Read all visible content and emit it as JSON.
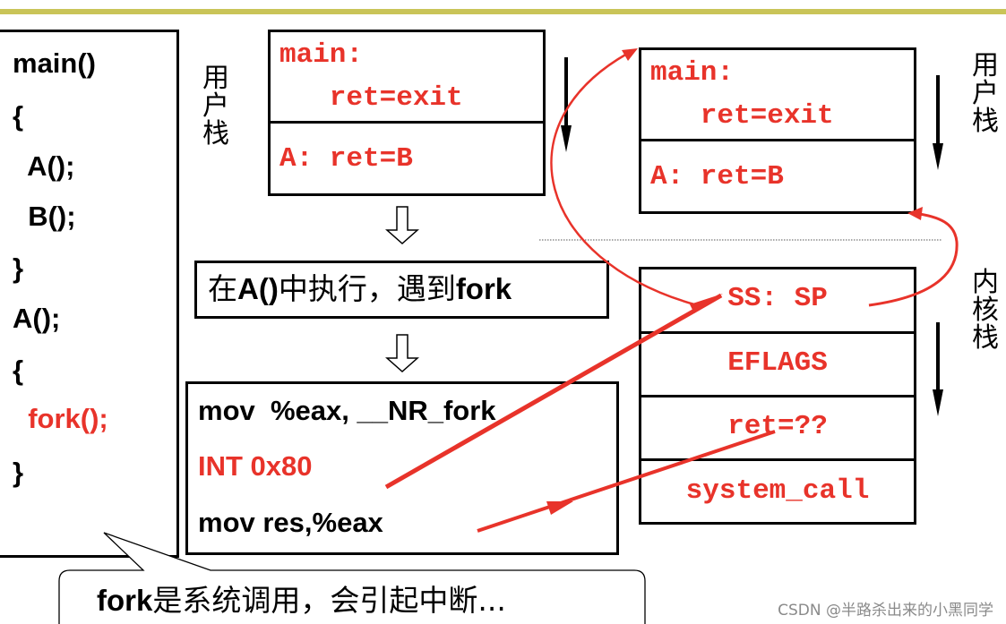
{
  "code_panel": {
    "lines": [
      "main()",
      "{",
      "  A();",
      "  B();",
      "}",
      "A();",
      "{",
      "  fork();",
      "}"
    ],
    "highlight_line": "  fork();"
  },
  "user_stack_left": {
    "label": "用户栈",
    "label_chars": [
      "用",
      "户",
      "栈"
    ],
    "frames": [
      {
        "line1": "main:",
        "line2": "   ret=exit"
      },
      {
        "line1": "A: ret=B"
      }
    ]
  },
  "flow": {
    "step1": {
      "prefix": "在",
      "bold1": "A()",
      "middle": "中执行，遇到",
      "bold2": "fork"
    },
    "asm": {
      "line1": "mov  %eax, __NR_fork",
      "line2": "INT 0x80",
      "line3": "mov res,%eax"
    }
  },
  "user_stack_right": {
    "label_chars": [
      "用",
      "户",
      "栈"
    ],
    "frames": [
      {
        "line1": "main:",
        "line2": "   ret=exit"
      },
      {
        "line1": "A: ret=B"
      }
    ]
  },
  "kernel_stack": {
    "label": "内核栈",
    "label_chars": [
      "内",
      "核",
      "栈"
    ],
    "frames": [
      "SS: SP",
      "EFLAGS",
      "ret=??",
      "system_call"
    ]
  },
  "callout": {
    "bold": "fork",
    "text": "是系统调用，会引起中断..."
  },
  "colors": {
    "accent_red": "#e8332a",
    "top_bar": "#c9c458",
    "watermark": "#8a8a8a"
  },
  "watermark": "CSDN @半路杀出来的小黑同学"
}
